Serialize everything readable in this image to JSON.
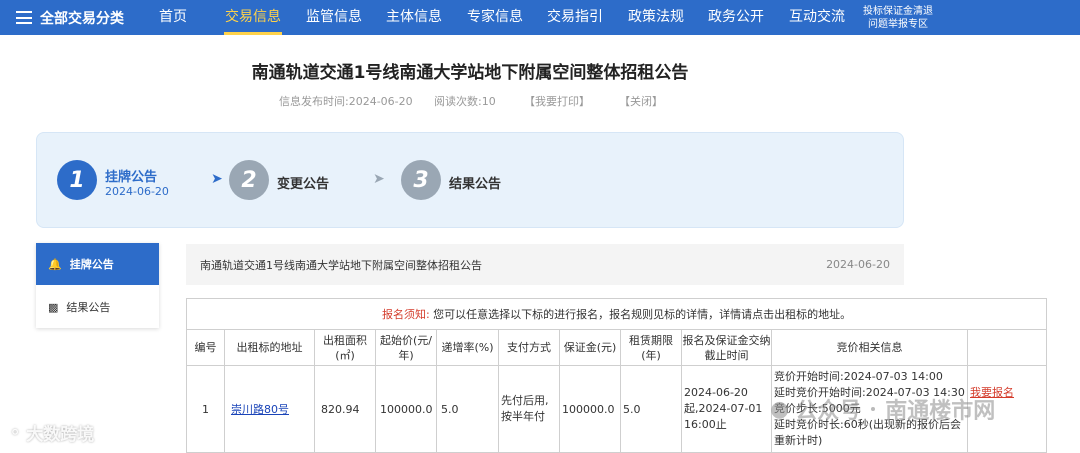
{
  "nav": {
    "category": "全部交易分类",
    "items": [
      {
        "label": "首页",
        "active": false
      },
      {
        "label": "交易信息",
        "active": true
      },
      {
        "label": "监管信息",
        "active": false
      },
      {
        "label": "主体信息",
        "active": false
      },
      {
        "label": "专家信息",
        "active": false
      },
      {
        "label": "交易指引",
        "active": false
      },
      {
        "label": "政策法规",
        "active": false
      },
      {
        "label": "政务公开",
        "active": false
      },
      {
        "label": "互动交流",
        "active": false
      }
    ],
    "small_line1": "投标保证金清退",
    "small_line2": "问题举报专区"
  },
  "article": {
    "title": "南通轨道交通1号线南通大学站地下附属空间整体招租公告",
    "publish_time": "信息发布时间:2024-06-20",
    "read_count": "阅读次数:10",
    "print": "【我要打印】",
    "close": "【关闭】"
  },
  "steps": [
    {
      "num": "1",
      "label": "挂牌公告",
      "date": "2024-06-20",
      "active": true
    },
    {
      "num": "2",
      "label": "变更公告",
      "active": false
    },
    {
      "num": "3",
      "label": "结果公告",
      "active": false
    }
  ],
  "sidebar": {
    "items": [
      {
        "label": "挂牌公告",
        "icon": "bell-icon"
      },
      {
        "label": "结果公告",
        "icon": "document-icon"
      }
    ]
  },
  "notice_bar": {
    "title": "南通轨道交通1号线南通大学站地下附属空间整体招租公告",
    "date": "2024-06-20"
  },
  "table": {
    "notice_prefix": "报名须知:",
    "notice_text": "您可以任意选择以下标的进行报名，报名规则见标的详情，详情请点击出租标的地址。",
    "headers": [
      "编号",
      "出租标的地址",
      "出租面积(㎡)",
      "起始价(元/年)",
      "递增率(%)",
      "支付方式",
      "保证金(元)",
      "租赁期限(年)",
      "报名及保证金交纳截止时间",
      "竞价相关信息",
      ""
    ],
    "row": {
      "no": "1",
      "address": "崇川路80号",
      "area": "820.94",
      "start_price": "100000.0",
      "increase_rate": "5.0",
      "payment": "先付后用,按半年付",
      "deposit": "100000.0",
      "term": "5.0",
      "deadline": "2024-06-20起,2024-07-01 16:00止",
      "bid_start": "竞价开始时间:2024-07-03 14:00",
      "delay_start": "延时竞价开始时间:2024-07-03 14:30",
      "step": "竞价步长:5000元",
      "delay_duration": "延时竞价时长:60秒(出现新的报价后会重新计时)",
      "signup": "我要报名"
    }
  },
  "watermarks": {
    "left": "大数跨境",
    "right_a": "公众号",
    "right_b": "南通楼市网"
  }
}
